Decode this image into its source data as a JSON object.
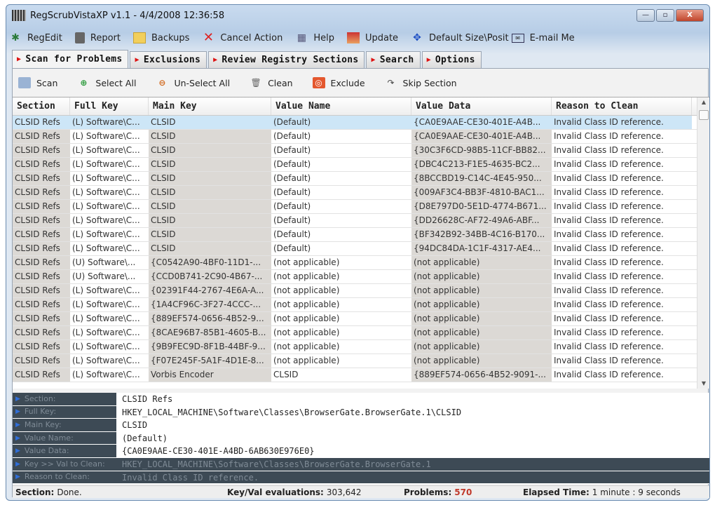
{
  "title": "RegScrubVistaXP v1.1  -  4/4/2008 12:36:58",
  "window_buttons": {
    "minimize": "—",
    "maximize": "▫",
    "close": "X"
  },
  "menu": [
    {
      "label": "RegEdit",
      "icon": "regedit-icon"
    },
    {
      "label": "Report",
      "icon": "report-icon"
    },
    {
      "label": "Backups",
      "icon": "folder-icon"
    },
    {
      "label": "Cancel Action",
      "icon": "cancel-x-icon"
    },
    {
      "label": "Help",
      "icon": "help-icon"
    },
    {
      "label": "Update",
      "icon": "update-icon"
    },
    {
      "label": "Default Size\\Posit",
      "icon": "move-arrows-icon"
    },
    {
      "label": "E-mail Me",
      "icon": "email-icon"
    }
  ],
  "tabs": [
    "Scan for Problems",
    "Exclusions",
    "Review Registry Sections",
    "Search",
    "Options"
  ],
  "actions": [
    "Scan",
    "Select All",
    "Un-Select All",
    "Clean",
    "Exclude",
    "Skip Section"
  ],
  "columns": [
    "Section",
    "Full Key",
    "Main Key",
    "Value Name",
    "Value Data",
    "Reason to Clean"
  ],
  "rows": [
    [
      "CLSID Refs",
      "(L) Software\\C...",
      "CLSID",
      "(Default)",
      "{CA0E9AAE-CE30-401E-A4B...",
      "Invalid Class ID reference."
    ],
    [
      "CLSID Refs",
      "(L) Software\\C...",
      "CLSID",
      "(Default)",
      "{CA0E9AAE-CE30-401E-A4B...",
      "Invalid Class ID reference."
    ],
    [
      "CLSID Refs",
      "(L) Software\\C...",
      "CLSID",
      "(Default)",
      "{30C3F6CD-98B5-11CF-BB82...",
      "Invalid Class ID reference."
    ],
    [
      "CLSID Refs",
      "(L) Software\\C...",
      "CLSID",
      "(Default)",
      "{DBC4C213-F1E5-4635-BC2...",
      "Invalid Class ID reference."
    ],
    [
      "CLSID Refs",
      "(L) Software\\C...",
      "CLSID",
      "(Default)",
      "{8BCCBD19-C14C-4E45-950...",
      "Invalid Class ID reference."
    ],
    [
      "CLSID Refs",
      "(L) Software\\C...",
      "CLSID",
      "(Default)",
      "{009AF3C4-BB3F-4810-BAC1...",
      "Invalid Class ID reference."
    ],
    [
      "CLSID Refs",
      "(L) Software\\C...",
      "CLSID",
      "(Default)",
      "{D8E797D0-5E1D-4774-B671...",
      "Invalid Class ID reference."
    ],
    [
      "CLSID Refs",
      "(L) Software\\C...",
      "CLSID",
      "(Default)",
      "{DD26628C-AF72-49A6-ABF...",
      "Invalid Class ID reference."
    ],
    [
      "CLSID Refs",
      "(L) Software\\C...",
      "CLSID",
      "(Default)",
      "{BF342B92-34BB-4C16-B170...",
      "Invalid Class ID reference."
    ],
    [
      "CLSID Refs",
      "(L) Software\\C...",
      "CLSID",
      "(Default)",
      "{94DC84DA-1C1F-4317-AE4...",
      "Invalid Class ID reference."
    ],
    [
      "CLSID Refs",
      "(U) Software\\...",
      "{C0542A90-4BF0-11D1-...",
      "(not applicable)",
      "(not applicable)",
      "Invalid Class ID reference."
    ],
    [
      "CLSID Refs",
      "(U) Software\\...",
      "{CCD0B741-2C90-4B67-...",
      "(not applicable)",
      "(not applicable)",
      "Invalid Class ID reference."
    ],
    [
      "CLSID Refs",
      "(L) Software\\C...",
      "{02391F44-2767-4E6A-A...",
      "(not applicable)",
      "(not applicable)",
      "Invalid Class ID reference."
    ],
    [
      "CLSID Refs",
      "(L) Software\\C...",
      "{1A4CF96C-3F27-4CCC-...",
      "(not applicable)",
      "(not applicable)",
      "Invalid Class ID reference."
    ],
    [
      "CLSID Refs",
      "(L) Software\\C...",
      "{889EF574-0656-4B52-9...",
      "(not applicable)",
      "(not applicable)",
      "Invalid Class ID reference."
    ],
    [
      "CLSID Refs",
      "(L) Software\\C...",
      "{8CAE96B7-85B1-4605-B...",
      "(not applicable)",
      "(not applicable)",
      "Invalid Class ID reference."
    ],
    [
      "CLSID Refs",
      "(L) Software\\C...",
      "{9B9FEC9D-8F1B-44BF-9...",
      "(not applicable)",
      "(not applicable)",
      "Invalid Class ID reference."
    ],
    [
      "CLSID Refs",
      "(L) Software\\C...",
      "{F07E245F-5A1F-4D1E-8...",
      "(not applicable)",
      "(not applicable)",
      "Invalid Class ID reference."
    ],
    [
      "CLSID Refs",
      "(L) Software\\C...",
      "Vorbis Encoder",
      "CLSID",
      "{889EF574-0656-4B52-9091-...",
      "Invalid Class ID reference."
    ]
  ],
  "details": [
    {
      "label": "Section:",
      "value": "CLSID Refs"
    },
    {
      "label": "Full Key:",
      "value": "HKEY_LOCAL_MACHINE\\Software\\Classes\\BrowserGate.BrowserGate.1\\CLSID"
    },
    {
      "label": "Main Key:",
      "value": "CLSID"
    },
    {
      "label": "Value Name:",
      "value": "(Default)"
    },
    {
      "label": "Value Data:",
      "value": "{CA0E9AAE-CE30-401E-A4BD-6AB630E976E0}"
    },
    {
      "label": "Key >> Val to Clean:",
      "value": "HKEY_LOCAL_MACHINE\\Software\\Classes\\BrowserGate.BrowserGate.1"
    },
    {
      "label": "Reason to Clean:",
      "value": "Invalid Class ID reference."
    }
  ],
  "status": {
    "section_label": "Section:",
    "section_value": "Done.",
    "evals_label": "Key/Val evaluations:",
    "evals_value": "303,642",
    "problems_label": "Problems:",
    "problems_value": "570",
    "elapsed_label": "Elapsed Time:",
    "elapsed_value": "1 minute : 9 seconds"
  },
  "colors": {
    "problems": "#c0392b",
    "selected_row": "#cde6f7",
    "detail_dark": "#3d4a55"
  }
}
